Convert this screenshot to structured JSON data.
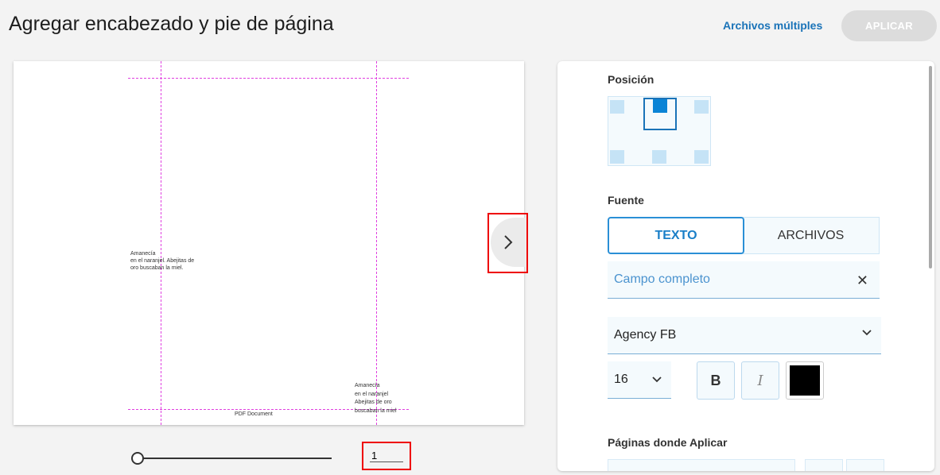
{
  "header": {
    "title": "Agregar encabezado y pie de página",
    "multi_files": "Archivos múltiples",
    "apply": "APLICAR"
  },
  "preview": {
    "left_text": "Amanecía\nen el naranjel. Abejitas de\noro buscaban la miel.",
    "right_text": "Amanecía\nen el naranjel\nAbejitas de oro\nbuscaban la miel",
    "footer_text": "PDF Document",
    "page_number": "1"
  },
  "settings": {
    "position_label": "Posición",
    "source_label": "Fuente",
    "tab_text": "TEXTO",
    "tab_files": "ARCHIVOS",
    "content_value": "Campo completo",
    "font_value": "Agency FB",
    "size_value": "16",
    "bold_label": "B",
    "italic_label": "I",
    "color": "#000000",
    "pages_label": "Páginas donde Aplicar"
  }
}
